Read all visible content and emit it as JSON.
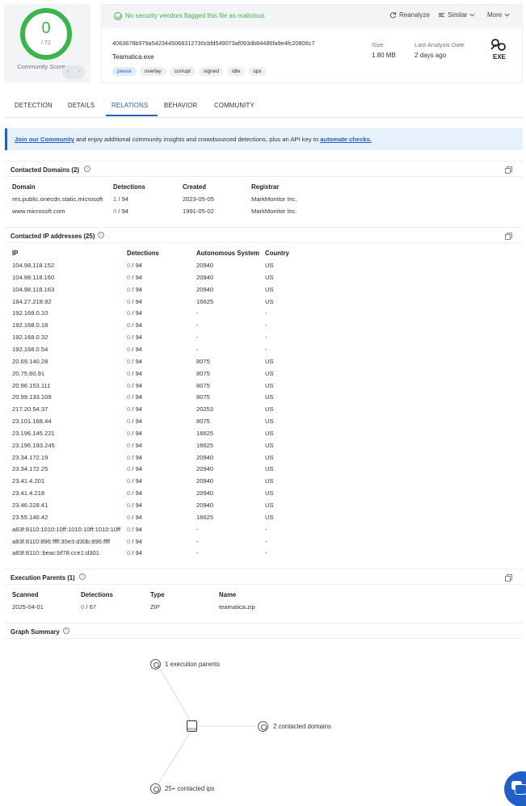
{
  "score": {
    "detections": "0",
    "total": "/ 72",
    "community_label": "Community Score",
    "pill_minus": "-",
    "pill_plus": "-"
  },
  "header": {
    "status": "No security vendors flagged this file as malicious",
    "reanalyze": "Reanalyze",
    "similar": "Similar",
    "more": "More",
    "hash": "4063678b979a5423445068312730cbfd549073af093db84486fa9e4fc20806c7",
    "filename": "Teamatica.exe",
    "tags": [
      "peexe",
      "overlay",
      "corrupt",
      "signed",
      "idle",
      "upx"
    ],
    "size_label": "Size",
    "size_value": "1.80 MB",
    "analysis_label": "Last Analysis Date",
    "analysis_value": "2 days ago",
    "filetype": "EXE"
  },
  "tabs": [
    "DETECTION",
    "DETAILS",
    "RELATIONS",
    "BEHAVIOR",
    "COMMUNITY"
  ],
  "banner": {
    "link1": "Join our Community",
    "middle": " and enjoy additional community insights and crowdsourced detections, plus an API key to ",
    "link2": "automate checks."
  },
  "domains": {
    "title": "Contacted Domains",
    "count": "(2)",
    "columns": [
      "Domain",
      "Detections",
      "Created",
      "Registrar"
    ],
    "rows": [
      {
        "domain": "res.public.onecdn.static.microsoft",
        "det": "1",
        "total": " / 94",
        "created": "2023-05-05",
        "registrar": "MarkMonitor Inc."
      },
      {
        "domain": "www.microsoft.com",
        "det": "0",
        "total": " / 94",
        "created": "1991-05-02",
        "registrar": "MarkMonitor Inc."
      }
    ]
  },
  "ips": {
    "title": "Contacted IP addresses",
    "count": "(25)",
    "columns": [
      "IP",
      "Detections",
      "Autonomous System",
      "Country"
    ],
    "rows": [
      {
        "ip": "104.98.118.152",
        "det": "0",
        "total": " / 94",
        "as": "20940",
        "country": "US"
      },
      {
        "ip": "104.98.118.160",
        "det": "0",
        "total": " / 94",
        "as": "20940",
        "country": "US"
      },
      {
        "ip": "104.98.118.163",
        "det": "0",
        "total": " / 94",
        "as": "20940",
        "country": "US"
      },
      {
        "ip": "184.27.218.92",
        "det": "0",
        "total": " / 94",
        "as": "16625",
        "country": "US"
      },
      {
        "ip": "192.168.0.10",
        "det": "0",
        "total": " / 94",
        "as": "-",
        "country": "-"
      },
      {
        "ip": "192.168.0.18",
        "det": "0",
        "total": " / 94",
        "as": "-",
        "country": "-"
      },
      {
        "ip": "192.168.0.32",
        "det": "0",
        "total": " / 94",
        "as": "-",
        "country": "-"
      },
      {
        "ip": "192.168.0.54",
        "det": "0",
        "total": " / 94",
        "as": "-",
        "country": "-"
      },
      {
        "ip": "20.69.140.28",
        "det": "0",
        "total": " / 94",
        "as": "8075",
        "country": "US"
      },
      {
        "ip": "20.75.60.91",
        "det": "0",
        "total": " / 94",
        "as": "8075",
        "country": "US"
      },
      {
        "ip": "20.96.153.111",
        "det": "0",
        "total": " / 94",
        "as": "8075",
        "country": "US"
      },
      {
        "ip": "20.99.133.109",
        "det": "0",
        "total": " / 94",
        "as": "8075",
        "country": "US"
      },
      {
        "ip": "217.20.54.37",
        "det": "0",
        "total": " / 94",
        "as": "20253",
        "country": "US"
      },
      {
        "ip": "23.101.168.44",
        "det": "0",
        "total": " / 94",
        "as": "8075",
        "country": "US"
      },
      {
        "ip": "23.196.145.221",
        "det": "0",
        "total": " / 94",
        "as": "16625",
        "country": "US"
      },
      {
        "ip": "23.196.193.245",
        "det": "0",
        "total": " / 94",
        "as": "16625",
        "country": "US"
      },
      {
        "ip": "23.34.172.19",
        "det": "0",
        "total": " / 94",
        "as": "20940",
        "country": "US"
      },
      {
        "ip": "23.34.172.25",
        "det": "0",
        "total": " / 94",
        "as": "20940",
        "country": "US"
      },
      {
        "ip": "23.41.4.201",
        "det": "0",
        "total": " / 94",
        "as": "20940",
        "country": "US"
      },
      {
        "ip": "23.41.4.218",
        "det": "0",
        "total": " / 94",
        "as": "20940",
        "country": "US"
      },
      {
        "ip": "23.46.228.41",
        "det": "0",
        "total": " / 94",
        "as": "20940",
        "country": "US"
      },
      {
        "ip": "23.55.140.42",
        "det": "0",
        "total": " / 94",
        "as": "16625",
        "country": "US"
      },
      {
        "ip": "a83f:8110:1010:10ff:1010:10ff:1010:10ff",
        "det": "0",
        "total": " / 94",
        "as": "-",
        "country": "-"
      },
      {
        "ip": "a83f:8110:896:ffff:30e3:d30b:896:ffff",
        "det": "0",
        "total": " / 94",
        "as": "-",
        "country": "-"
      },
      {
        "ip": "a83f:8110::beac:bf78:cce1:d301",
        "det": "0",
        "total": " / 94",
        "as": "-",
        "country": "-"
      }
    ]
  },
  "parents": {
    "title": "Execution Parents",
    "count": "(1)",
    "columns": [
      "Scanned",
      "Detections",
      "Type",
      "Name"
    ],
    "rows": [
      {
        "scanned": "2025-04-01",
        "det": "0",
        "total": " / 67",
        "type": "ZIP",
        "name": "teamatica.zip"
      }
    ]
  },
  "graph": {
    "title": "Graph Summary",
    "center": "PEEXE",
    "parents": "1 execution parents",
    "domains": "2 contacted domains",
    "ips": "25+ contacted ips"
  },
  "colors": {
    "accent": "#1f5fc7",
    "clean": "#3ab54a",
    "malicious": "#d93025"
  }
}
